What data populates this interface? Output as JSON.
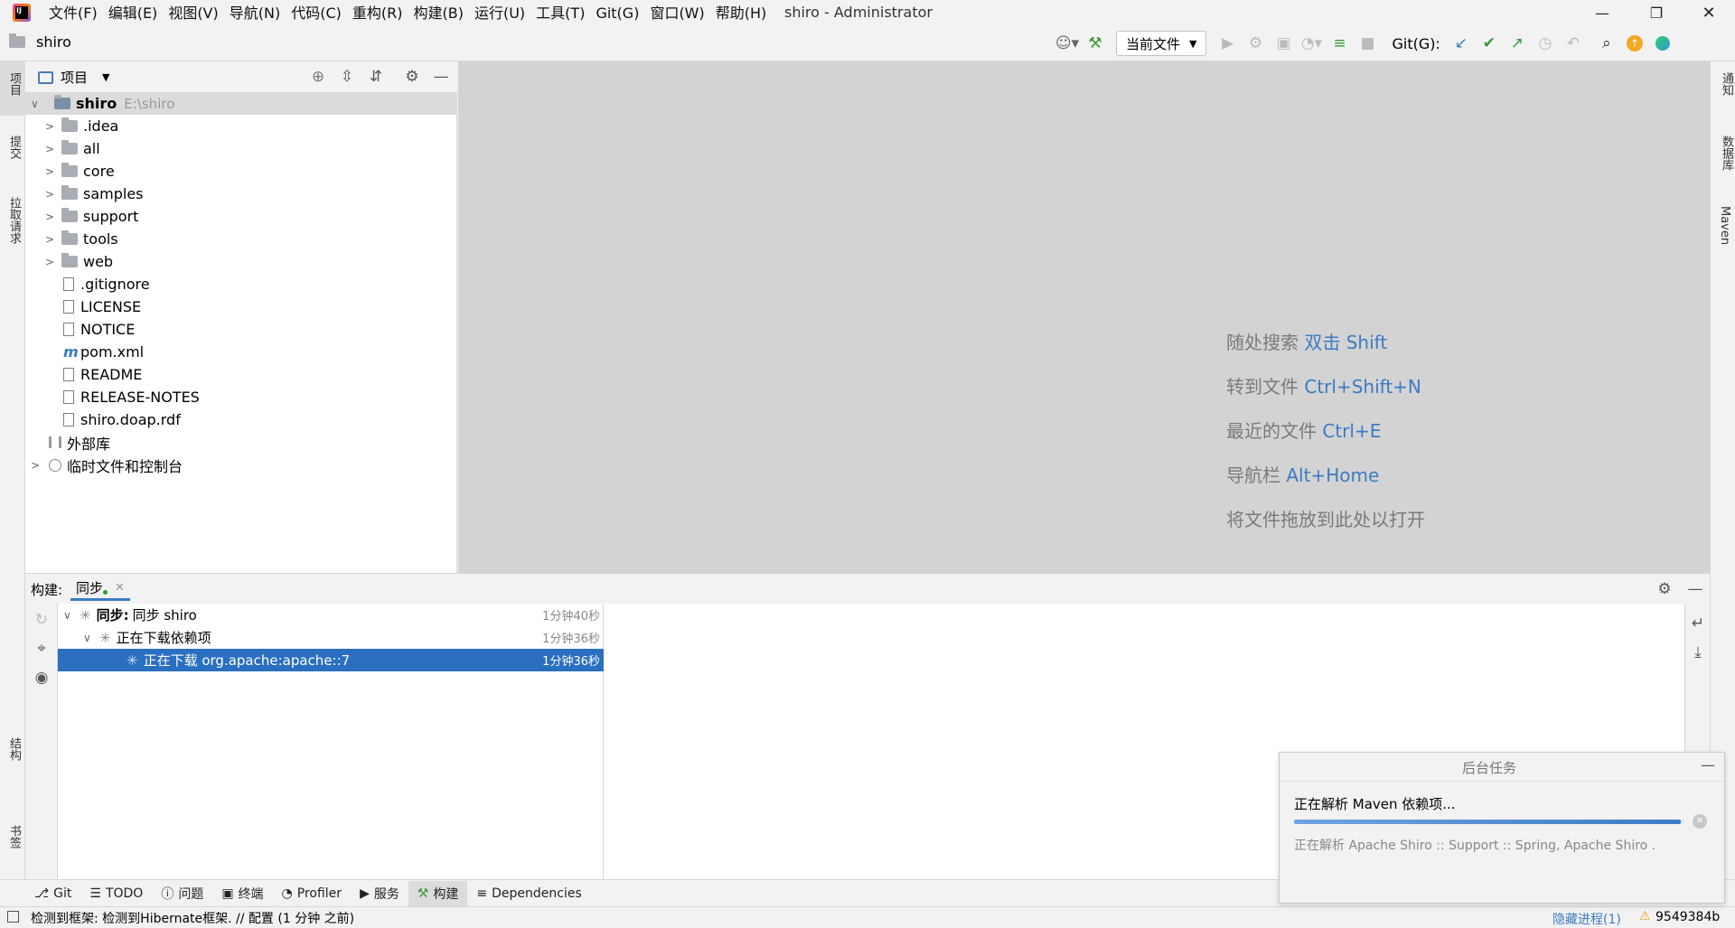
{
  "app": {
    "window_title": "shiro - Administrator",
    "menu": [
      "文件(F)",
      "编辑(E)",
      "视图(V)",
      "导航(N)",
      "代码(C)",
      "重构(R)",
      "构建(B)",
      "运行(U)",
      "工具(T)",
      "Git(G)",
      "窗口(W)",
      "帮助(H)"
    ],
    "project_breadcrumb": "shiro"
  },
  "toolbar": {
    "run_config": "当前文件",
    "git_label": "Git(G):"
  },
  "left_strip": {
    "top": [
      "项目",
      "提交",
      "拉取请求"
    ],
    "bottom": [
      "结构",
      "书签"
    ]
  },
  "right_strip": [
    "通知",
    "数据库",
    "Maven"
  ],
  "project": {
    "view_label": "项目",
    "root": {
      "name": "shiro",
      "path": "E:\\shiro"
    },
    "folders": [
      ".idea",
      "all",
      "core",
      "samples",
      "support",
      "tools",
      "web"
    ],
    "files": [
      ".gitignore",
      "LICENSE",
      "NOTICE",
      "pom.xml",
      "README",
      "RELEASE-NOTES",
      "shiro.doap.rdf"
    ],
    "external_libs": "外部库",
    "scratches": "临时文件和控制台"
  },
  "editor_hints": [
    {
      "text": "随处搜索",
      "key": "双击 Shift"
    },
    {
      "text": "转到文件",
      "key": "Ctrl+Shift+N"
    },
    {
      "text": "最近的文件",
      "key": "Ctrl+E"
    },
    {
      "text": "导航栏",
      "key": "Alt+Home"
    },
    {
      "text": "将文件拖放到此处以打开",
      "key": ""
    }
  ],
  "build": {
    "label": "构建:",
    "tab": "同步",
    "rows": [
      {
        "prefix": "同步:",
        "text": "同步 shiro",
        "time": "1分钟40秒"
      },
      {
        "prefix": "",
        "text": "正在下载依赖项",
        "time": "1分钟36秒"
      },
      {
        "prefix": "",
        "text": "正在下载 org.apache:apache::7",
        "time": "1分钟36秒"
      }
    ]
  },
  "bottom_tabs": [
    "Git",
    "TODO",
    "问题",
    "终端",
    "Profiler",
    "服务",
    "构建",
    "Dependencies"
  ],
  "status": {
    "message": "检测到框架: 检测到Hibernate框架. // 配置 (1 分钟 之前)",
    "hidden_processes": "隐藏进程(1)",
    "memory": "9549384b"
  },
  "background_tasks": {
    "title": "后台任务",
    "task": "正在解析 Maven 依赖项...",
    "progress": 0.99,
    "detail": "正在解析 Apache Shiro :: Support :: Spring, Apache Shiro ."
  },
  "colors": {
    "accent": "#3c7bc4",
    "selection": "#2a6fc0",
    "editor_bg": "#d3d3d3"
  }
}
